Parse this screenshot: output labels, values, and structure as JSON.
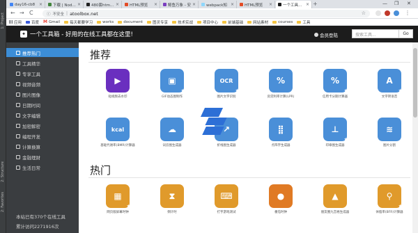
{
  "ide": {
    "panel_labels": [
      "1: Project",
      "2: Structure",
      "2: Favorites"
    ]
  },
  "browser": {
    "tabs": [
      {
        "label": "day16-cb8",
        "color": "#4285f4"
      },
      {
        "label": "下载 | Node.js",
        "color": "#43853d"
      },
      {
        "label": "480套html全",
        "color": "#222222"
      },
      {
        "label": "HTML预览",
        "color": "#e34c26"
      },
      {
        "label": "鲸鱼万象 - 安",
        "color": "#7b3fbf"
      },
      {
        "label": "webpack知",
        "color": "#8ed6fb"
      },
      {
        "label": "HTML预览",
        "color": "#e34c26"
      },
      {
        "label": "一个工具箱 - 好",
        "color": "#1c1c1c"
      }
    ],
    "new_tab": "+",
    "window_controls": [
      "—",
      "❐",
      "✕"
    ],
    "nav": {
      "back": "←",
      "forward": "→",
      "reload": "C"
    },
    "security_label": "不安全",
    "url": "atoolbox.net",
    "bookmarks": [
      {
        "type": "apps",
        "label": "应用"
      },
      {
        "type": "page",
        "label": "百度"
      },
      {
        "type": "gmail",
        "label": "Gmail"
      },
      {
        "type": "folder",
        "label": "每天都要学习"
      },
      {
        "type": "folder",
        "label": "works"
      },
      {
        "type": "folder",
        "label": "document"
      },
      {
        "type": "folder",
        "label": "图灵专享"
      },
      {
        "type": "folder",
        "label": "技术实战"
      },
      {
        "type": "folder",
        "label": "项目中心"
      },
      {
        "type": "folder",
        "label": "前端基础"
      },
      {
        "type": "folder",
        "label": "网站素材"
      },
      {
        "type": "folder",
        "label": "courses"
      },
      {
        "type": "folder",
        "label": "工具"
      }
    ]
  },
  "site": {
    "logo_glyph": "✦",
    "title": "一个工具箱 - 好用的在线工具都在这里!",
    "login": "会员登陆",
    "search_placeholder": "搜索工具...",
    "search_button": "Go"
  },
  "sidebar": {
    "items": [
      {
        "label": "推荐热门",
        "active": true
      },
      {
        "label": "工具精华",
        "active": false
      },
      {
        "label": "专享工具",
        "active": false
      },
      {
        "label": "视频音频",
        "active": false
      },
      {
        "label": "图片图像",
        "active": false
      },
      {
        "label": "日期时间",
        "active": false
      },
      {
        "label": "文字编辑",
        "active": false
      },
      {
        "label": "加密解密",
        "active": false
      },
      {
        "label": "编程开发",
        "active": false
      },
      {
        "label": "计算换算",
        "active": false
      },
      {
        "label": "金融理财",
        "active": false
      },
      {
        "label": "生活日常",
        "active": false
      }
    ],
    "footer_lines": [
      "本站已有370个在线工具",
      "累计访问2271916次"
    ]
  },
  "sections": [
    {
      "title": "推荐",
      "tools": [
        {
          "label": "短视频去水印",
          "icon": "video-icon",
          "glyph": "▶",
          "color": "purple",
          "star": true
        },
        {
          "label": "GIF动态图制作",
          "icon": "gif-frame-icon",
          "glyph": "▣",
          "color": "blue",
          "star": true
        },
        {
          "label": "图片文字识别",
          "icon": "ocr-icon",
          "glyph": "OCR",
          "color": "blue",
          "star": true
        },
        {
          "label": "房贷利率计算(LPR)",
          "icon": "percent-icon",
          "glyph": "%",
          "color": "blue",
          "star": false
        },
        {
          "label": "信用卡分期计算器",
          "icon": "card-percent-icon",
          "glyph": "%",
          "color": "blue",
          "star": true
        },
        {
          "label": "文字转语音",
          "icon": "translate-icon",
          "glyph": "A",
          "color": "blue",
          "star": true
        },
        {
          "label": "基础代谢率(BMR)计算器",
          "icon": "kcal-icon",
          "glyph": "kcal",
          "color": "blue",
          "star": false
        },
        {
          "label": "词云图生成器",
          "icon": "cloud-icon",
          "glyph": "☁",
          "color": "blue",
          "star": false
        },
        {
          "label": "折线图生成器",
          "icon": "chart-icon",
          "glyph": "↗",
          "color": "blue",
          "star": false
        },
        {
          "label": "点阵字生成器",
          "icon": "dot-matrix-icon",
          "glyph": "⣿",
          "color": "blue",
          "star": false
        },
        {
          "label": "印章图生成器",
          "icon": "stamp-icon",
          "glyph": "⊥",
          "color": "blue",
          "star": true
        },
        {
          "label": "图片分割",
          "icon": "layers-icon",
          "glyph": "≋",
          "color": "blue",
          "star": false
        }
      ]
    },
    {
      "title": "热门",
      "tools": [
        {
          "label": "网页版屏幕时钟",
          "icon": "calendar-icon",
          "glyph": "▦",
          "color": "orange",
          "star": true
        },
        {
          "label": "倒计时",
          "icon": "hourglass-icon",
          "glyph": "⧗",
          "color": "orange",
          "star": false
        },
        {
          "label": "打字游戏测试",
          "icon": "keyboard-icon",
          "glyph": "⌨",
          "color": "orange",
          "star": false
        },
        {
          "label": "番茄时钟",
          "icon": "tomato-icon",
          "glyph": "●",
          "color": "red",
          "star": false
        },
        {
          "label": "朋友圈九宫格生成器",
          "icon": "tree-image-icon",
          "glyph": "▲",
          "color": "orange",
          "star": false
        },
        {
          "label": "体脂率(BFR)计算器",
          "icon": "bmi-icon",
          "glyph": "⚲",
          "color": "orange",
          "star": true
        }
      ]
    }
  ]
}
